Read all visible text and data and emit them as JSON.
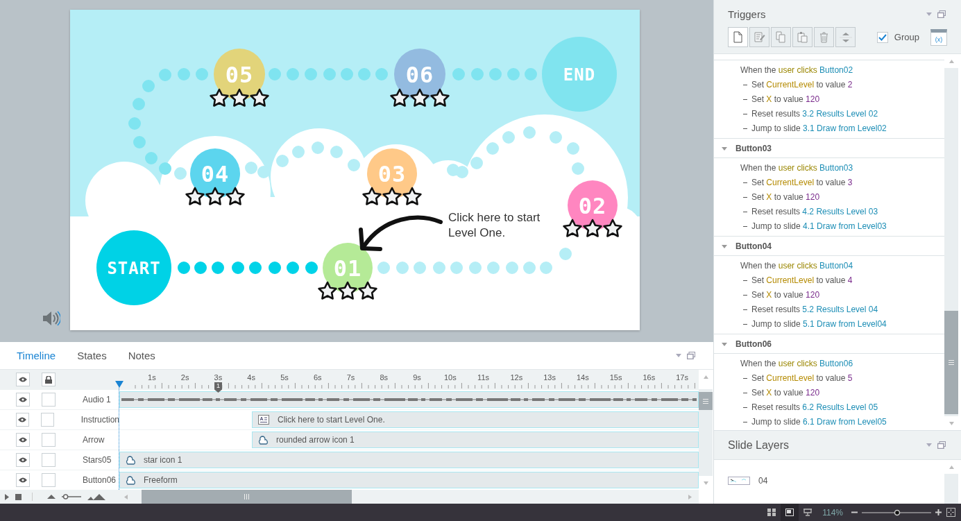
{
  "slide": {
    "nodes": [
      {
        "label": "START",
        "color": "#00d2e6"
      },
      {
        "label": "01",
        "color": "#b5ea97",
        "stars": 0
      },
      {
        "label": "02",
        "color": "#ff86c0",
        "stars": 0
      },
      {
        "label": "03",
        "color": "#ffc988",
        "stars": 0
      },
      {
        "label": "04",
        "color": "#5cd5ee",
        "stars": 0
      },
      {
        "label": "05",
        "color": "#e2d47a",
        "stars": 0
      },
      {
        "label": "06",
        "color": "#93bbe0",
        "stars": 0
      },
      {
        "label": "END",
        "color": "#80e4ef"
      }
    ],
    "hint": "Click here to start Level One."
  },
  "timeline": {
    "tabs": [
      {
        "label": "Timeline",
        "selected": true
      },
      {
        "label": "States",
        "selected": false
      },
      {
        "label": "Notes",
        "selected": false
      }
    ],
    "ruler": [
      "1s",
      "2s",
      "3s",
      "4s",
      "5s",
      "6s",
      "7s",
      "8s",
      "9s",
      "10s",
      "11s",
      "12s",
      "13s",
      "14s",
      "15s",
      "16s",
      "17s"
    ],
    "marker_label": "1",
    "rows": [
      {
        "label": "Audio 1",
        "visible": true,
        "locked": false,
        "kind": "audio"
      },
      {
        "label": "Instruction",
        "visible": true,
        "locked": false,
        "kind": "text",
        "item": "Click here to start Level One."
      },
      {
        "label": "Arrow",
        "visible": true,
        "locked": false,
        "kind": "shape",
        "item": "rounded arrow icon 1"
      },
      {
        "label": "Stars05",
        "visible": true,
        "locked": false,
        "kind": "shape",
        "item": "star icon 1"
      },
      {
        "label": "Button06",
        "visible": true,
        "locked": false,
        "kind": "shape",
        "item": "Freeform"
      }
    ],
    "zoom": {
      "level": 0.2
    }
  },
  "triggers": {
    "title": "Triggers",
    "toolbar": [
      {
        "kind": "new",
        "disabled": false
      },
      {
        "kind": "edit",
        "disabled": true
      },
      {
        "kind": "copy",
        "disabled": true
      },
      {
        "kind": "paste",
        "disabled": true
      },
      {
        "kind": "delete",
        "disabled": true
      },
      {
        "kind": "move",
        "disabled": true
      }
    ],
    "group": {
      "label": "Group",
      "checked": true
    },
    "variables_label": "(x)",
    "groups": [
      {
        "event": [
          {
            "text": "When the ",
            "kind": "plain"
          },
          {
            "text": "user clicks ",
            "kind": "event"
          },
          {
            "text": "Button02",
            "kind": "object"
          }
        ],
        "actions": [
          [
            {
              "text": "Set ",
              "kind": "plain"
            },
            {
              "text": "CurrentLevel",
              "kind": "variable"
            },
            {
              "text": " to value ",
              "kind": "plain"
            },
            {
              "text": "2",
              "kind": "value"
            }
          ],
          [
            {
              "text": "Set ",
              "kind": "plain"
            },
            {
              "text": "X",
              "kind": "variable"
            },
            {
              "text": " to value ",
              "kind": "plain"
            },
            {
              "text": "120",
              "kind": "value"
            }
          ],
          [
            {
              "text": "Reset results ",
              "kind": "plain"
            },
            {
              "text": "3.2 Results Level 02",
              "kind": "object"
            }
          ],
          [
            {
              "text": "Jump to slide ",
              "kind": "plain"
            },
            {
              "text": "3.1 Draw from Level02",
              "kind": "object"
            }
          ]
        ]
      },
      {
        "name": "Button03",
        "expanded": true,
        "event": [
          {
            "text": "When the ",
            "kind": "plain"
          },
          {
            "text": "user clicks ",
            "kind": "event"
          },
          {
            "text": "Button03",
            "kind": "object"
          }
        ],
        "actions": [
          [
            {
              "text": "Set ",
              "kind": "plain"
            },
            {
              "text": "CurrentLevel",
              "kind": "variable"
            },
            {
              "text": " to value ",
              "kind": "plain"
            },
            {
              "text": "3",
              "kind": "value"
            }
          ],
          [
            {
              "text": "Set ",
              "kind": "plain"
            },
            {
              "text": "X",
              "kind": "variable"
            },
            {
              "text": " to value ",
              "kind": "plain"
            },
            {
              "text": "120",
              "kind": "value"
            }
          ],
          [
            {
              "text": "Reset results ",
              "kind": "plain"
            },
            {
              "text": "4.2 Results Level 03",
              "kind": "object"
            }
          ],
          [
            {
              "text": "Jump to slide ",
              "kind": "plain"
            },
            {
              "text": "4.1 Draw from Level03",
              "kind": "object"
            }
          ]
        ]
      },
      {
        "name": "Button04",
        "expanded": true,
        "event": [
          {
            "text": "When the ",
            "kind": "plain"
          },
          {
            "text": "user clicks ",
            "kind": "event"
          },
          {
            "text": "Button04",
            "kind": "object"
          }
        ],
        "actions": [
          [
            {
              "text": "Set ",
              "kind": "plain"
            },
            {
              "text": "CurrentLevel",
              "kind": "variable"
            },
            {
              "text": " to value ",
              "kind": "plain"
            },
            {
              "text": "4",
              "kind": "value"
            }
          ],
          [
            {
              "text": "Set ",
              "kind": "plain"
            },
            {
              "text": "X",
              "kind": "variable"
            },
            {
              "text": " to value ",
              "kind": "plain"
            },
            {
              "text": "120",
              "kind": "value"
            }
          ],
          [
            {
              "text": "Reset results ",
              "kind": "plain"
            },
            {
              "text": "5.2 Results Level 04",
              "kind": "object"
            }
          ],
          [
            {
              "text": "Jump to slide ",
              "kind": "plain"
            },
            {
              "text": "5.1 Draw from Level04",
              "kind": "object"
            }
          ]
        ]
      },
      {
        "name": "Button06",
        "expanded": true,
        "event": [
          {
            "text": "When the ",
            "kind": "plain"
          },
          {
            "text": "user clicks ",
            "kind": "event"
          },
          {
            "text": "Button06",
            "kind": "object"
          }
        ],
        "actions": [
          [
            {
              "text": "Set ",
              "kind": "plain"
            },
            {
              "text": "CurrentLevel",
              "kind": "variable"
            },
            {
              "text": " to value ",
              "kind": "plain"
            },
            {
              "text": "5",
              "kind": "value"
            }
          ],
          [
            {
              "text": "Set ",
              "kind": "plain"
            },
            {
              "text": "X",
              "kind": "variable"
            },
            {
              "text": " to value ",
              "kind": "plain"
            },
            {
              "text": "120",
              "kind": "value"
            }
          ],
          [
            {
              "text": "Reset results ",
              "kind": "plain"
            },
            {
              "text": "6.2 Results Level 05",
              "kind": "object"
            }
          ],
          [
            {
              "text": "Jump to slide ",
              "kind": "plain"
            },
            {
              "text": "6.1 Draw from Level05",
              "kind": "object"
            }
          ]
        ]
      }
    ]
  },
  "layers": {
    "title": "Slide Layers",
    "items": [
      {
        "label": "04"
      }
    ]
  },
  "status_bar": {
    "zoom_text": "114%",
    "zoom": {
      "level": 0.51
    }
  }
}
